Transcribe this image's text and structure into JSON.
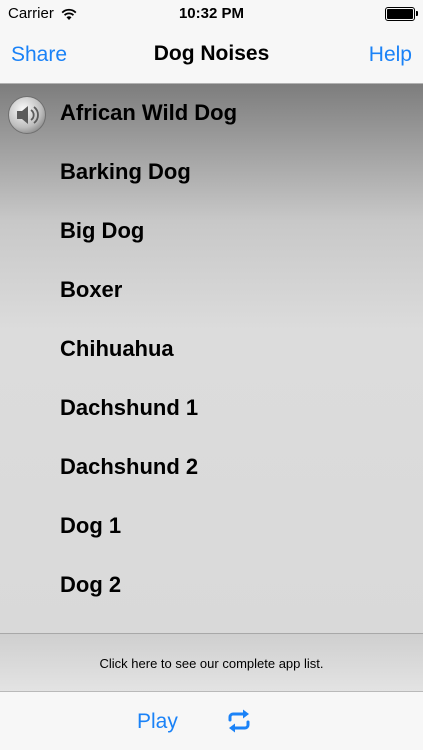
{
  "status_bar": {
    "carrier": "Carrier",
    "time": "10:32 PM"
  },
  "nav": {
    "left_button": "Share",
    "title": "Dog Noises",
    "right_button": "Help"
  },
  "sounds": [
    {
      "label": "African Wild Dog",
      "playing": true
    },
    {
      "label": "Barking Dog"
    },
    {
      "label": "Big Dog"
    },
    {
      "label": "Boxer"
    },
    {
      "label": "Chihuahua"
    },
    {
      "label": "Dachshund 1"
    },
    {
      "label": "Dachshund 2"
    },
    {
      "label": "Dog 1"
    },
    {
      "label": "Dog 2"
    }
  ],
  "footer": {
    "app_list_text": "Click here to see our complete app list."
  },
  "toolbar": {
    "play_label": "Play",
    "repeat_icon": "repeat-icon"
  },
  "colors": {
    "accent": "#1a82f7"
  }
}
